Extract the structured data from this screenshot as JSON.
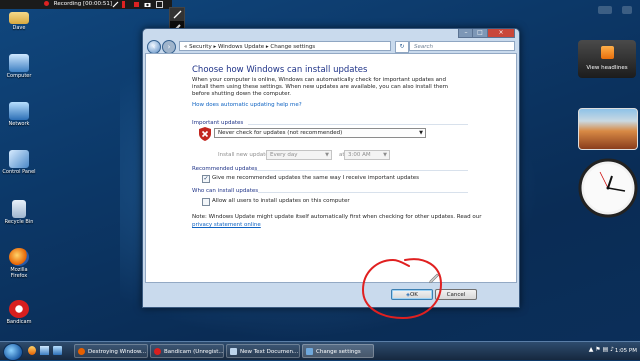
{
  "recorder": {
    "status": "Recording [00:00:51]"
  },
  "desktop_icons": [
    {
      "label": "Dave"
    },
    {
      "label": "Computer"
    },
    {
      "label": "Network"
    },
    {
      "label": "Control Panel"
    },
    {
      "label": "Recycle Bin"
    },
    {
      "label": "Mozilla Firefox"
    },
    {
      "label": "Bandicam"
    }
  ],
  "window": {
    "breadcrumb": "« Security ▸ Windows Update ▸ Change settings",
    "search_placeholder": "Search",
    "heading": "Choose how Windows can install updates",
    "intro": "When your computer is online, Windows can automatically check for important updates and install them using these settings. When new updates are available, you can also install them before shutting down the computer.",
    "help_link": "How does automatic updating help me?",
    "important": {
      "label": "Important updates",
      "selected": "Never check for updates (not recommended)",
      "install_label": "Install new updates:",
      "day": "Every day",
      "at_label": "at",
      "time": "3:00 AM"
    },
    "recommended": {
      "label": "Recommended updates",
      "checkbox": "Give me recommended updates the same way I receive important updates"
    },
    "who": {
      "label": "Who can install updates",
      "checkbox": "Allow all users to install updates on this computer"
    },
    "note": "Note: Windows Update might update itself automatically first when checking for other updates.  Read our",
    "privacy_link": "privacy statement online",
    "ok_label": "OK",
    "cancel_label": "Cancel"
  },
  "gadgets": {
    "rss": "View headlines"
  },
  "taskbar": {
    "tasks": [
      {
        "label": "Destroying Window..."
      },
      {
        "label": "Bandicam (Unregist..."
      },
      {
        "label": "New Text Documen..."
      },
      {
        "label": "Change settings"
      }
    ],
    "time": "1:05 PM"
  },
  "colors": {
    "annotation_circle": "#e02020",
    "accent": "#1e3287",
    "link": "#0d62c2"
  }
}
